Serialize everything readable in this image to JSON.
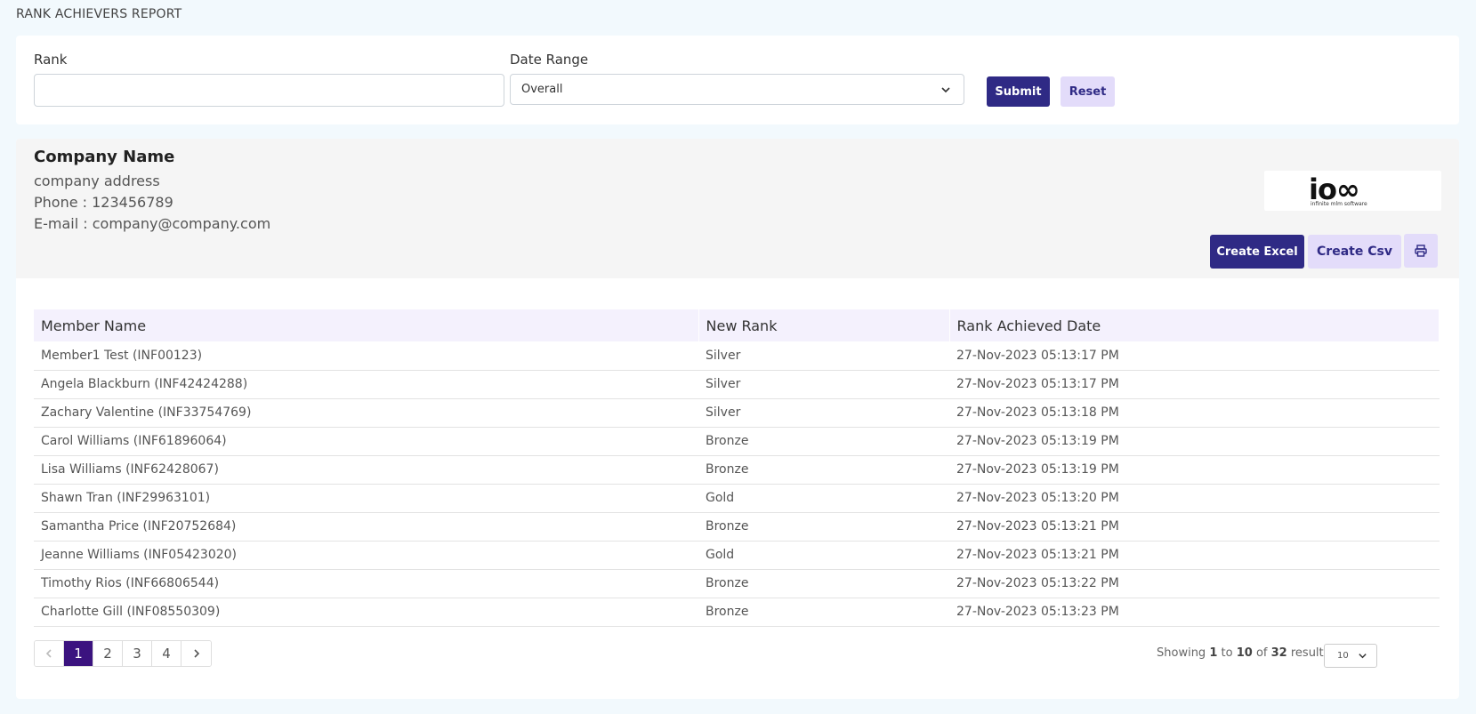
{
  "page": {
    "title": "RANK ACHIEVERS REPORT"
  },
  "filters": {
    "rank_label": "Rank",
    "rank_value": "",
    "date_range_label": "Date Range",
    "date_range_value": "Overall",
    "submit_label": "Submit",
    "reset_label": "Reset"
  },
  "company": {
    "name": "Company Name",
    "address": "company address",
    "phone": "Phone : 123456789",
    "email": "E-mail : company@company.com",
    "logo_text": "io∞",
    "logo_subtext": "infinite mlm software"
  },
  "actions": {
    "create_excel_label": "Create Excel",
    "create_csv_label": "Create Csv",
    "print_icon": "print-icon"
  },
  "table": {
    "headers": [
      "Member Name",
      "New Rank",
      "Rank Achieved Date"
    ],
    "rows": [
      [
        "Member1  Test  (INF00123)",
        "Silver",
        "27-Nov-2023 05:13:17 PM"
      ],
      [
        "Angela  Blackburn  (INF42424288)",
        "Silver",
        "27-Nov-2023 05:13:17 PM"
      ],
      [
        "Zachary  Valentine  (INF33754769)",
        "Silver",
        "27-Nov-2023 05:13:18 PM"
      ],
      [
        "Carol  Williams  (INF61896064)",
        "Bronze",
        "27-Nov-2023 05:13:19 PM"
      ],
      [
        "Lisa  Williams  (INF62428067)",
        "Bronze",
        "27-Nov-2023 05:13:19 PM"
      ],
      [
        "Shawn  Tran  (INF29963101)",
        "Gold",
        "27-Nov-2023 05:13:20 PM"
      ],
      [
        "Samantha  Price  (INF20752684)",
        "Bronze",
        "27-Nov-2023 05:13:21 PM"
      ],
      [
        "Jeanne  Williams  (INF05423020)",
        "Gold",
        "27-Nov-2023 05:13:21 PM"
      ],
      [
        "Timothy  Rios  (INF66806544)",
        "Bronze",
        "27-Nov-2023 05:13:22 PM"
      ],
      [
        "Charlotte  Gill  (INF08550309)",
        "Bronze",
        "27-Nov-2023 05:13:23 PM"
      ]
    ]
  },
  "pagination": {
    "prev_icon": "chevron-left-icon",
    "pages": [
      "1",
      "2",
      "3",
      "4"
    ],
    "current_page": "1",
    "next_icon": "chevron-right-icon",
    "showing_prefix": "Showing",
    "showing_from": "1",
    "showing_to_word": "to",
    "showing_to": "10",
    "showing_of_word": "of",
    "showing_total": "32",
    "showing_suffix": "results",
    "per_page_value": "10"
  },
  "colors": {
    "primary": "#2f2a85",
    "light_button": "#e3dcfa",
    "active_page": "#3b137f",
    "table_header_bg": "#f4f1fd"
  }
}
